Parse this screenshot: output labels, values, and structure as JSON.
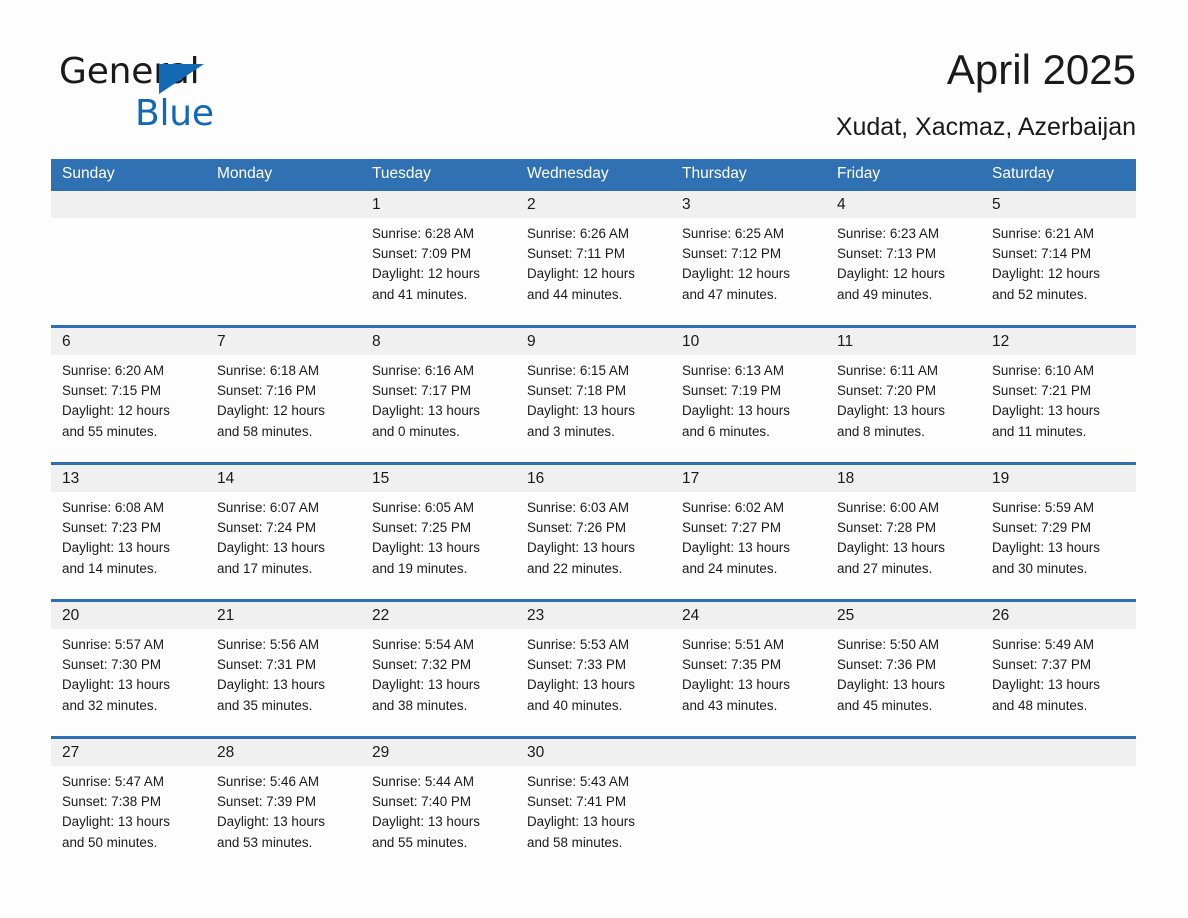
{
  "logo": {
    "general_text": "General",
    "blue_text": "Blue",
    "triangle_color": "#1268b3"
  },
  "header": {
    "title": "April 2025",
    "subtitle": "Xudat, Xacmaz, Azerbaijan"
  },
  "theme": {
    "header_blue": "#3071b4",
    "row_divider_blue": "#2d6fb0",
    "daynum_band": "#f0f0f0",
    "page_background": "#fdfdfd",
    "text": "#1a1a1a"
  },
  "weekdays": [
    "Sunday",
    "Monday",
    "Tuesday",
    "Wednesday",
    "Thursday",
    "Friday",
    "Saturday"
  ],
  "weeks": [
    {
      "days": [
        {
          "num": "",
          "sunrise": "",
          "sunset": "",
          "daylight1": "",
          "daylight2": "",
          "empty": true
        },
        {
          "num": "",
          "sunrise": "",
          "sunset": "",
          "daylight1": "",
          "daylight2": "",
          "empty": true
        },
        {
          "num": "1",
          "sunrise": "Sunrise: 6:28 AM",
          "sunset": "Sunset: 7:09 PM",
          "daylight1": "Daylight: 12 hours",
          "daylight2": "and 41 minutes."
        },
        {
          "num": "2",
          "sunrise": "Sunrise: 6:26 AM",
          "sunset": "Sunset: 7:11 PM",
          "daylight1": "Daylight: 12 hours",
          "daylight2": "and 44 minutes."
        },
        {
          "num": "3",
          "sunrise": "Sunrise: 6:25 AM",
          "sunset": "Sunset: 7:12 PM",
          "daylight1": "Daylight: 12 hours",
          "daylight2": "and 47 minutes."
        },
        {
          "num": "4",
          "sunrise": "Sunrise: 6:23 AM",
          "sunset": "Sunset: 7:13 PM",
          "daylight1": "Daylight: 12 hours",
          "daylight2": "and 49 minutes."
        },
        {
          "num": "5",
          "sunrise": "Sunrise: 6:21 AM",
          "sunset": "Sunset: 7:14 PM",
          "daylight1": "Daylight: 12 hours",
          "daylight2": "and 52 minutes."
        }
      ]
    },
    {
      "days": [
        {
          "num": "6",
          "sunrise": "Sunrise: 6:20 AM",
          "sunset": "Sunset: 7:15 PM",
          "daylight1": "Daylight: 12 hours",
          "daylight2": "and 55 minutes."
        },
        {
          "num": "7",
          "sunrise": "Sunrise: 6:18 AM",
          "sunset": "Sunset: 7:16 PM",
          "daylight1": "Daylight: 12 hours",
          "daylight2": "and 58 minutes."
        },
        {
          "num": "8",
          "sunrise": "Sunrise: 6:16 AM",
          "sunset": "Sunset: 7:17 PM",
          "daylight1": "Daylight: 13 hours",
          "daylight2": "and 0 minutes."
        },
        {
          "num": "9",
          "sunrise": "Sunrise: 6:15 AM",
          "sunset": "Sunset: 7:18 PM",
          "daylight1": "Daylight: 13 hours",
          "daylight2": "and 3 minutes."
        },
        {
          "num": "10",
          "sunrise": "Sunrise: 6:13 AM",
          "sunset": "Sunset: 7:19 PM",
          "daylight1": "Daylight: 13 hours",
          "daylight2": "and 6 minutes."
        },
        {
          "num": "11",
          "sunrise": "Sunrise: 6:11 AM",
          "sunset": "Sunset: 7:20 PM",
          "daylight1": "Daylight: 13 hours",
          "daylight2": "and 8 minutes."
        },
        {
          "num": "12",
          "sunrise": "Sunrise: 6:10 AM",
          "sunset": "Sunset: 7:21 PM",
          "daylight1": "Daylight: 13 hours",
          "daylight2": "and 11 minutes."
        }
      ]
    },
    {
      "days": [
        {
          "num": "13",
          "sunrise": "Sunrise: 6:08 AM",
          "sunset": "Sunset: 7:23 PM",
          "daylight1": "Daylight: 13 hours",
          "daylight2": "and 14 minutes."
        },
        {
          "num": "14",
          "sunrise": "Sunrise: 6:07 AM",
          "sunset": "Sunset: 7:24 PM",
          "daylight1": "Daylight: 13 hours",
          "daylight2": "and 17 minutes."
        },
        {
          "num": "15",
          "sunrise": "Sunrise: 6:05 AM",
          "sunset": "Sunset: 7:25 PM",
          "daylight1": "Daylight: 13 hours",
          "daylight2": "and 19 minutes."
        },
        {
          "num": "16",
          "sunrise": "Sunrise: 6:03 AM",
          "sunset": "Sunset: 7:26 PM",
          "daylight1": "Daylight: 13 hours",
          "daylight2": "and 22 minutes."
        },
        {
          "num": "17",
          "sunrise": "Sunrise: 6:02 AM",
          "sunset": "Sunset: 7:27 PM",
          "daylight1": "Daylight: 13 hours",
          "daylight2": "and 24 minutes."
        },
        {
          "num": "18",
          "sunrise": "Sunrise: 6:00 AM",
          "sunset": "Sunset: 7:28 PM",
          "daylight1": "Daylight: 13 hours",
          "daylight2": "and 27 minutes."
        },
        {
          "num": "19",
          "sunrise": "Sunrise: 5:59 AM",
          "sunset": "Sunset: 7:29 PM",
          "daylight1": "Daylight: 13 hours",
          "daylight2": "and 30 minutes."
        }
      ]
    },
    {
      "days": [
        {
          "num": "20",
          "sunrise": "Sunrise: 5:57 AM",
          "sunset": "Sunset: 7:30 PM",
          "daylight1": "Daylight: 13 hours",
          "daylight2": "and 32 minutes."
        },
        {
          "num": "21",
          "sunrise": "Sunrise: 5:56 AM",
          "sunset": "Sunset: 7:31 PM",
          "daylight1": "Daylight: 13 hours",
          "daylight2": "and 35 minutes."
        },
        {
          "num": "22",
          "sunrise": "Sunrise: 5:54 AM",
          "sunset": "Sunset: 7:32 PM",
          "daylight1": "Daylight: 13 hours",
          "daylight2": "and 38 minutes."
        },
        {
          "num": "23",
          "sunrise": "Sunrise: 5:53 AM",
          "sunset": "Sunset: 7:33 PM",
          "daylight1": "Daylight: 13 hours",
          "daylight2": "and 40 minutes."
        },
        {
          "num": "24",
          "sunrise": "Sunrise: 5:51 AM",
          "sunset": "Sunset: 7:35 PM",
          "daylight1": "Daylight: 13 hours",
          "daylight2": "and 43 minutes."
        },
        {
          "num": "25",
          "sunrise": "Sunrise: 5:50 AM",
          "sunset": "Sunset: 7:36 PM",
          "daylight1": "Daylight: 13 hours",
          "daylight2": "and 45 minutes."
        },
        {
          "num": "26",
          "sunrise": "Sunrise: 5:49 AM",
          "sunset": "Sunset: 7:37 PM",
          "daylight1": "Daylight: 13 hours",
          "daylight2": "and 48 minutes."
        }
      ]
    },
    {
      "days": [
        {
          "num": "27",
          "sunrise": "Sunrise: 5:47 AM",
          "sunset": "Sunset: 7:38 PM",
          "daylight1": "Daylight: 13 hours",
          "daylight2": "and 50 minutes."
        },
        {
          "num": "28",
          "sunrise": "Sunrise: 5:46 AM",
          "sunset": "Sunset: 7:39 PM",
          "daylight1": "Daylight: 13 hours",
          "daylight2": "and 53 minutes."
        },
        {
          "num": "29",
          "sunrise": "Sunrise: 5:44 AM",
          "sunset": "Sunset: 7:40 PM",
          "daylight1": "Daylight: 13 hours",
          "daylight2": "and 55 minutes."
        },
        {
          "num": "30",
          "sunrise": "Sunrise: 5:43 AM",
          "sunset": "Sunset: 7:41 PM",
          "daylight1": "Daylight: 13 hours",
          "daylight2": "and 58 minutes."
        },
        {
          "num": "",
          "sunrise": "",
          "sunset": "",
          "daylight1": "",
          "daylight2": "",
          "empty": true
        },
        {
          "num": "",
          "sunrise": "",
          "sunset": "",
          "daylight1": "",
          "daylight2": "",
          "empty": true
        },
        {
          "num": "",
          "sunrise": "",
          "sunset": "",
          "daylight1": "",
          "daylight2": "",
          "empty": true
        }
      ]
    }
  ]
}
